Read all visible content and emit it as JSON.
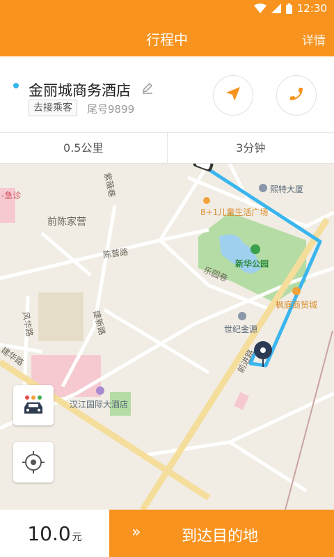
{
  "status_bar": {
    "time": "12:30",
    "icons": [
      "wifi-icon",
      "signal-icon",
      "battery-icon"
    ]
  },
  "header": {
    "title": "行程中",
    "details_label": "详情"
  },
  "trip": {
    "destination": "金丽城商务酒店",
    "status_tag": "去接乘客",
    "tail_number": "尾号9899",
    "distance": "0.5公里",
    "eta": "3分钟"
  },
  "map": {
    "road_labels": [
      "紫薇巷",
      "前陈家营",
      "陈营路",
      "乐园巷",
      "建新路",
      "风华路",
      "建华路",
      "前进路"
    ],
    "pois": {
      "building": "熙特大厦",
      "kids_mall": "8+1儿童生活广场",
      "park": "新华公园",
      "trade_city": "枫庭商贸城",
      "century": "世纪金源",
      "hotel": "汉江国际大酒店",
      "clinic": "-急诊"
    }
  },
  "fare": {
    "amount": "10.0",
    "unit": "元"
  },
  "action": {
    "chevrons": "»",
    "label": "到达目的地"
  },
  "colors": {
    "brand_orange": "#f7931e",
    "route_blue": "#3bb5ee",
    "park_green": "#b5dca5"
  }
}
